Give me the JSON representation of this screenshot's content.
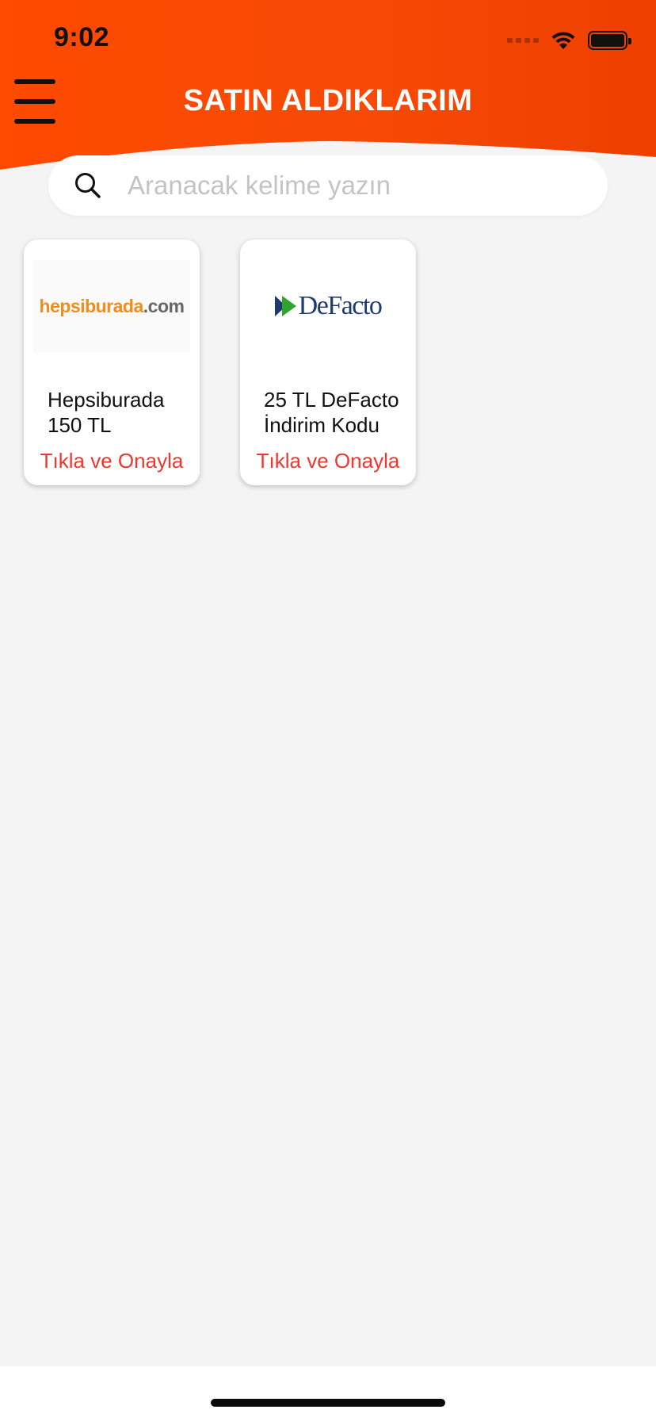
{
  "status_bar": {
    "time": "9:02"
  },
  "header": {
    "title": "SATIN ALDIKLARIM"
  },
  "search": {
    "placeholder": "Aranacak kelime yazın"
  },
  "cards": [
    {
      "logo_text_main": "hepsiburada",
      "logo_text_suffix": ".com",
      "title": "Hepsiburada 150 TL",
      "action": "Tıkla ve Onayla"
    },
    {
      "logo_text": "DeFacto",
      "title": "25 TL DeFacto İndirim Kodu",
      "action": "Tıkla ve Onayla"
    }
  ],
  "colors": {
    "header_orange": "#ff4a00",
    "action_red": "#f0362d",
    "background": "#f4f4f4",
    "hepsiburada_orange": "#f28c1c",
    "defacto_navy": "#1f3b6e",
    "defacto_green": "#2fa52e"
  },
  "icons": {
    "menu": "hamburger-menu-icon",
    "search": "search-icon",
    "wifi": "wifi-icon",
    "battery": "battery-icon",
    "signal": "cellular-signal-icon"
  }
}
